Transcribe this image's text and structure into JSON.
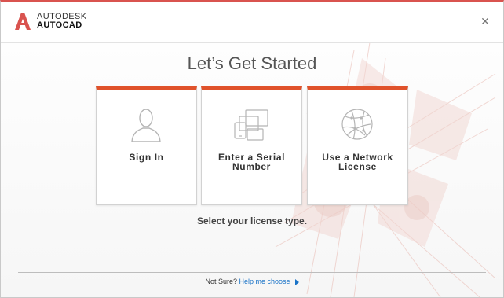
{
  "window": {
    "brand_line1": "AUTODESK",
    "brand_line2": "AUTOCAD",
    "brand_color": "#d9534f",
    "close_icon": "close-icon"
  },
  "main": {
    "title": "Let’s Get Started",
    "subtitle": "Select your license type."
  },
  "cards": [
    {
      "label": "Sign In",
      "icon": "user-icon"
    },
    {
      "label": "Enter a Serial\nNumber",
      "icon": "devices-icon"
    },
    {
      "label": "Use a Network\nLicense",
      "icon": "globe-network-icon"
    }
  ],
  "accent_color": "#e0522b",
  "footer": {
    "prefix": "Not Sure?",
    "link": "Help me choose"
  }
}
